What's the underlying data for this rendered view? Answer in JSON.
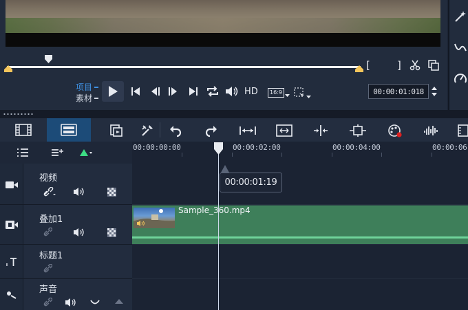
{
  "preview": {
    "mode_project": "项目",
    "mode_clip": "素材",
    "hd_label": "HD",
    "aspect_label": "16:9",
    "timecode": "00:00:01:018",
    "mark_in": "[",
    "mark_out": "]"
  },
  "ruler": {
    "ticks": [
      "00:00:00:00",
      "00:00:02:00",
      "00:00:04:00",
      "00:00:06"
    ]
  },
  "tooltip": {
    "time": "00:00:01:19"
  },
  "tracks": [
    {
      "name": "视频"
    },
    {
      "name": "叠加1"
    },
    {
      "name": "标题1"
    },
    {
      "name": "声音"
    }
  ],
  "clip": {
    "name": "Sample_360.mp4"
  },
  "colors": {
    "accent_blue": "#3f8fe0",
    "active_view": "#1c4b78",
    "clip_green": "#3e7f5a",
    "mark_yellow": "#f4c55b",
    "record_red": "#e02020",
    "add_green": "#3ddc84"
  },
  "icons": {
    "toolbar": [
      "storyboard-view-icon",
      "timeline-view-icon",
      "record-capture-icon",
      "tools-icon",
      "undo-icon",
      "redo-icon",
      "fit-timeline-icon",
      "smart-proxy-icon",
      "split-icon",
      "track-manager-icon",
      "paint-icon",
      "audio-mixer-icon",
      "filmstrip-icon"
    ]
  }
}
